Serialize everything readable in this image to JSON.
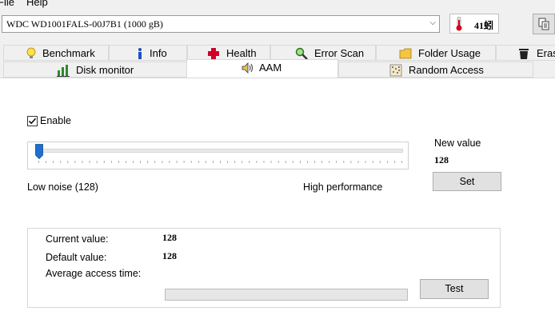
{
  "menu": {
    "file": "File",
    "help": "Help"
  },
  "drive": {
    "selected": "WDC WD1001FALS-00J7B1 (1000 gB)",
    "temperature": "41蚓"
  },
  "tabs_row1": [
    {
      "label": "Benchmark",
      "icon": "lightbulb-icon"
    },
    {
      "label": "Info",
      "icon": "info-icon"
    },
    {
      "label": "Health",
      "icon": "health-cross-icon"
    },
    {
      "label": "Error Scan",
      "icon": "magnifier-icon"
    },
    {
      "label": "Folder Usage",
      "icon": "folder-icon"
    },
    {
      "label": "Erase",
      "icon": "trash-icon"
    }
  ],
  "tabs_row2": [
    {
      "label": "Disk monitor",
      "icon": "chart-icon"
    },
    {
      "label": "AAM",
      "icon": "speaker-icon",
      "active": true
    },
    {
      "label": "Random Access",
      "icon": "dots-icon"
    }
  ],
  "aam": {
    "enable_label": "Enable",
    "enable_checked": true,
    "slider_min_label": "Low noise (128)",
    "slider_max_label": "High performance",
    "slider_value_fraction": 0.0,
    "new_value_label": "New value",
    "new_value": "128",
    "set_button": "Set",
    "current_label": "Current value:",
    "current_value": "128",
    "default_label": "Default value:",
    "default_value": "128",
    "avg_access_label": "Average access time:",
    "avg_access_progress": 0,
    "test_button": "Test"
  },
  "colors": {
    "active_tab_bg": "#ffffff",
    "panel_bg": "#ffffff",
    "thumb": "#1f6fd0"
  }
}
